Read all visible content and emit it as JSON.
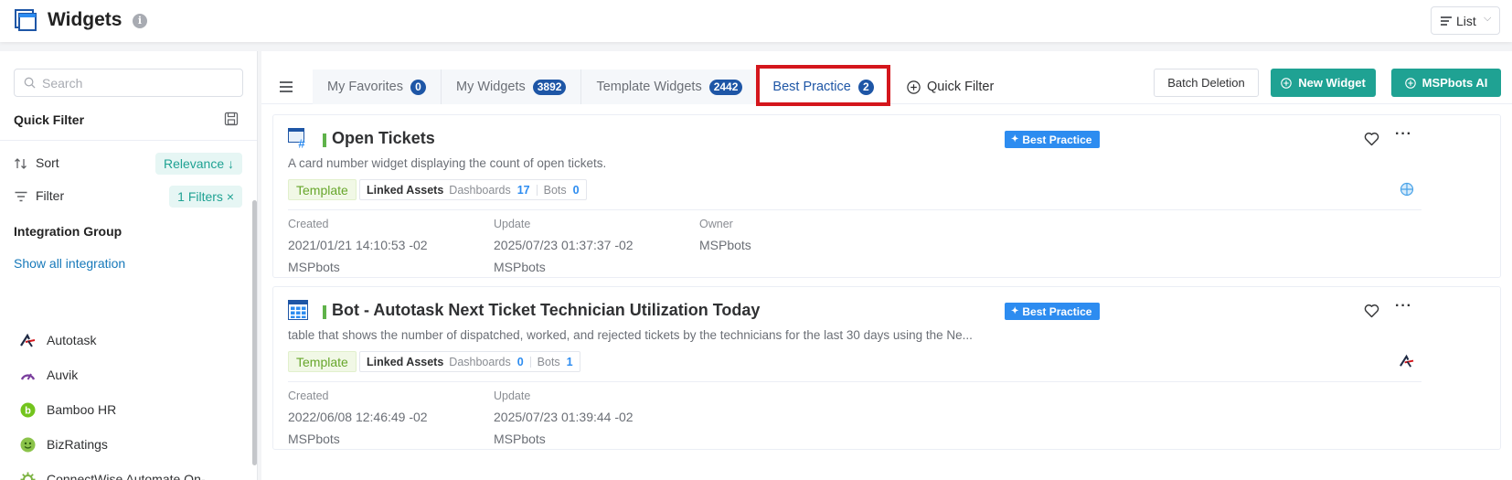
{
  "header": {
    "title": "Widgets",
    "info_icon": "info-icon",
    "view_mode": "List"
  },
  "sidebar": {
    "search_placeholder": "Search",
    "quick_filter_title": "Quick Filter",
    "sort": {
      "label": "Sort",
      "value": "Relevance ↓"
    },
    "filter": {
      "label": "Filter",
      "value": "1 Filters ×"
    },
    "integration_group_title": "Integration Group",
    "show_all_label": "Show all integration",
    "integrations": [
      {
        "name": "Autotask",
        "icon": "autotask-logo"
      },
      {
        "name": "Auvik",
        "icon": "auvik-logo"
      },
      {
        "name": "Bamboo HR",
        "icon": "bamboohr-logo"
      },
      {
        "name": "BizRatings",
        "icon": "bizratings-logo"
      },
      {
        "name": "ConnectWise Automate On-...",
        "icon": "connectwise-logo"
      }
    ]
  },
  "tabs": [
    {
      "label": "My Favorites",
      "count": "0"
    },
    {
      "label": "My Widgets",
      "count": "3892"
    },
    {
      "label": "Template Widgets",
      "count": "2442"
    },
    {
      "label": "Best Practice",
      "count": "2",
      "active": true
    }
  ],
  "toolbar": {
    "quick_filter_label": "Quick Filter",
    "batch_deletion_label": "Batch Deletion",
    "new_widget_label": "New Widget",
    "mspbots_ai_label": "MSPbots AI"
  },
  "colors": {
    "accent_teal": "#1fa293",
    "tab_active": "#1e56a6",
    "highlight_red": "#d4161c",
    "badge_blue": "#2d8cf0",
    "template_green": "#67a62b"
  },
  "widgets": [
    {
      "title": "Open Tickets",
      "badge": "Best Practice",
      "description": "A card number widget displaying the count of open tickets.",
      "tag": "Template",
      "linked_assets_label": "Linked Assets",
      "dashboards_label": "Dashboards",
      "dashboards_count": "17",
      "bots_label": "Bots",
      "bots_count": "0",
      "created_label": "Created",
      "created": "2021/01/21 14:10:53 -02",
      "created_by": "MSPbots",
      "update_label": "Update",
      "updated": "2025/07/23 01:37:37 -02",
      "updated_by": "MSPbots",
      "owner_label": "Owner",
      "owner": "MSPbots",
      "icon": "card-number-icon"
    },
    {
      "title": "Bot - Autotask Next Ticket Technician Utilization Today",
      "badge": "Best Practice",
      "description": "table that shows the number of dispatched, worked, and rejected tickets by the technicians for the last 30 days using the Ne...",
      "tag": "Template",
      "linked_assets_label": "Linked Assets",
      "dashboards_label": "Dashboards",
      "dashboards_count": "0",
      "bots_label": "Bots",
      "bots_count": "1",
      "created_label": "Created",
      "created": "2022/06/08 12:46:49 -02",
      "created_by": "MSPbots",
      "update_label": "Update",
      "updated": "2025/07/23 01:39:44 -02",
      "updated_by": "MSPbots",
      "icon": "table-icon"
    }
  ]
}
